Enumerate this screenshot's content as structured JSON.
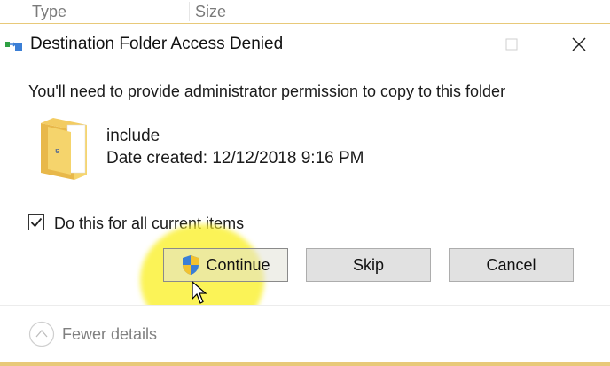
{
  "background_header": {
    "columns": [
      "Type",
      "Size"
    ]
  },
  "dialog": {
    "title": "Destination Folder Access Denied",
    "message": "You'll need to provide administrator permission to copy to this folder",
    "item": {
      "name": "include",
      "date_created": "Date created: 12/12/2018 9:16 PM"
    },
    "checkbox": {
      "label": "Do this for all current items",
      "checked": true
    },
    "buttons": {
      "continue": "Continue",
      "skip": "Skip",
      "cancel": "Cancel"
    },
    "footer": {
      "toggle_label": "Fewer details"
    }
  },
  "colors": {
    "highlight": "#f7ee2a",
    "accent_border": "#e8c979",
    "folder": "#f1c75b"
  },
  "icons": {
    "app": "copy-transfer-icon",
    "folder": "folder-icon",
    "shield": "uac-shield-icon",
    "checkbox": "checkmark-icon",
    "collapse": "chevron-up-circle-icon"
  }
}
